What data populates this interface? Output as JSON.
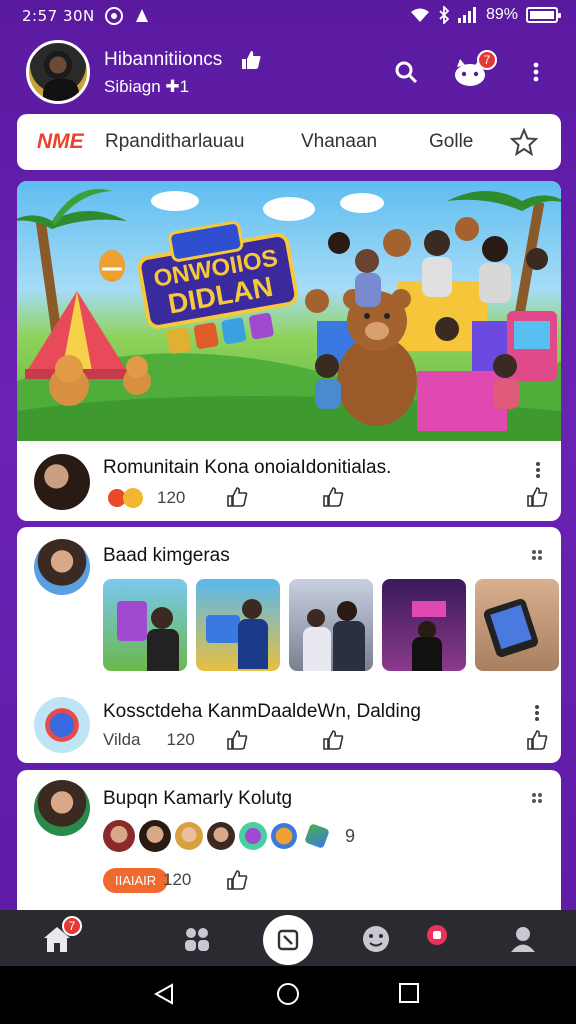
{
  "status_bar": {
    "time": "2:57 30N",
    "battery": "89%",
    "icons": [
      "whatsapp-icon",
      "notification-icon",
      "wifi-icon",
      "bluetooth-icon",
      "signal-icon",
      "battery-icon"
    ]
  },
  "header": {
    "name": "Hibannitiioncs",
    "subtitle": "Siɓiagn ✚1",
    "notification_count": "7",
    "icons": [
      "search-icon",
      "bell-icon",
      "more-vert-icon"
    ]
  },
  "tabs": [
    {
      "label": "NME"
    },
    {
      "label": "Rpanditharlauau"
    },
    {
      "label": "Vhanaan"
    },
    {
      "label": "Golle"
    }
  ],
  "banner": {
    "title_line1": "ONWOIIOS",
    "title_line2": "DIDLAN"
  },
  "posts": [
    {
      "title": "Romunitain Kona onoiaIdonitialas.",
      "count": "120",
      "icons": [
        "reaction-icon",
        "like-icon",
        "share-icon",
        "thumbs-up-icon"
      ]
    },
    {
      "title": "Baad kimgeras",
      "gallery_count": 5
    },
    {
      "title": "Kossctdeha KanmDaaldeWn, Dalding",
      "meta_label": "Vilda",
      "count": "120"
    },
    {
      "title": "Bupqn Kamarly Kolutg",
      "avatars_more": "9",
      "tag": "IIAIAIR",
      "count": "120"
    }
  ],
  "bottom_nav": {
    "home_badge": "7",
    "items": [
      "home",
      "groups",
      "create",
      "emoji",
      "live",
      "profile"
    ]
  },
  "colors": {
    "accent": "#6a22b4",
    "tag": "#f06a30",
    "badge": "#e53935"
  }
}
